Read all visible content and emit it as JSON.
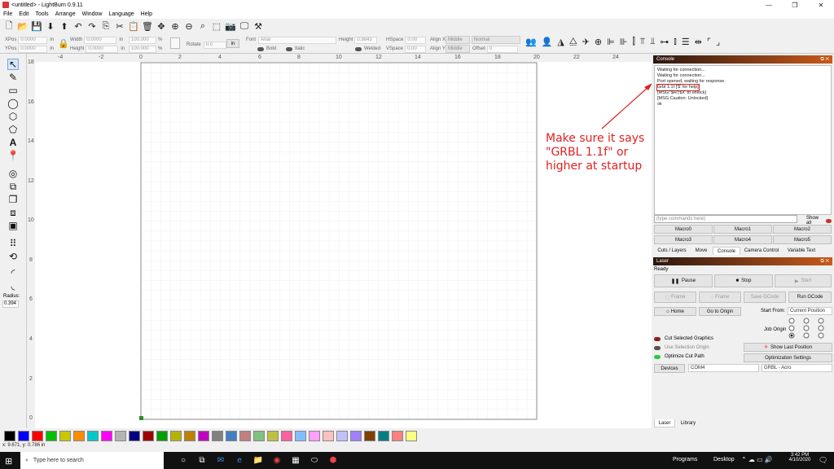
{
  "window": {
    "title": "<untitled> - LightBurn 0.9.11",
    "minimize": "—",
    "maximize": "❐",
    "close": "✕"
  },
  "menu": [
    "File",
    "Edit",
    "Tools",
    "Arrange",
    "Window",
    "Language",
    "Help"
  ],
  "props": {
    "xpos_label": "XPos",
    "xpos": "0.0000",
    "ypos_label": "YPos",
    "ypos": "0.0000",
    "unit": "in",
    "width_label": "Width",
    "width": "0.0000",
    "height_label": "Height",
    "height": "0.0000",
    "scale_w": "100.000",
    "scale_h": "100.000",
    "pct": "%",
    "rotate_label": "Rotate",
    "rotate": "0.0",
    "font_label": "Font",
    "font": "Arial",
    "bold": "Bold",
    "italic": "Italic",
    "fheight_label": "Height",
    "fheight": "0.9843",
    "welded": "Welded",
    "hspace_label": "HSpace",
    "hspace": "0.00",
    "vspace_label": "VSpace",
    "vspace": "0.00",
    "alignx_label": "Align X",
    "alignx": "Middle",
    "aligny_label": "Align Y",
    "aligny": "Middle",
    "normal": "Normal",
    "offset_label": "Offset",
    "offset": "0"
  },
  "rulers": {
    "top": [
      "-4",
      "-2",
      "0",
      "2",
      "4",
      "6",
      "8",
      "10",
      "12",
      "14",
      "16",
      "18",
      "20",
      "22",
      "24"
    ],
    "left": [
      "18",
      "16",
      "14",
      "12",
      "10",
      "8",
      "6",
      "4",
      "2",
      "0"
    ]
  },
  "radius": {
    "label": "Radius:",
    "value": "0.394"
  },
  "console": {
    "title": "Console",
    "lines": [
      "Waiting for connection...",
      "Waiting for connection...",
      "Port opened, waiting for response.",
      "Grbl 1.1f ['$' for help]",
      "[MSG:'$H'|'$X' to unlock]",
      "[MSG:Caution: Unlocked]",
      "ok"
    ],
    "cmd_placeholder": "(type commands here)",
    "show_all": "Show all"
  },
  "macros": [
    "Macro0",
    "Macro1",
    "Macro2",
    "Macro3",
    "Macro4",
    "Macro5"
  ],
  "tabs1": [
    "Cuts / Layers",
    "Move",
    "Console",
    "Camera Control",
    "Variable Text"
  ],
  "laser": {
    "title": "Laser",
    "status": "Ready",
    "pause": "Pause",
    "stop": "Stop",
    "start": "Start",
    "frame1": "Frame",
    "frame2": "Frame",
    "save_gcode": "Save GCode",
    "run_gcode": "Run GCode",
    "home": "Home",
    "go_origin": "Go to Origin",
    "start_from_label": "Start From:",
    "start_from": "Current Position",
    "job_origin": "Job Origin",
    "cut_selected": "Cut Selected Graphics",
    "use_selection": "Use Selection Origin",
    "optimize_path": "Optimize Cut Path",
    "show_last": "Show Last Position",
    "opt_settings": "Optimization Settings",
    "devices": "Devices",
    "port": "COM4",
    "device": "GRBL - Acro"
  },
  "tabs2": [
    "Laser",
    "Library"
  ],
  "palette": [
    "#000000",
    "#0000ff",
    "#ff0000",
    "#00c000",
    "#c8c800",
    "#ff8c00",
    "#00c8c8",
    "#ff00ff",
    "#b4b4b4",
    "#000080",
    "#a00000",
    "#00a000",
    "#b4b400",
    "#c08000",
    "#c000c0",
    "#808080",
    "#4080c0",
    "#c08080",
    "#80c080",
    "#c0c040",
    "#ff60a0",
    "#80c0ff",
    "#ffa0ff",
    "#ffc0c0",
    "#c0c0ff",
    "#a080ff",
    "#804000",
    "#008080",
    "#ff8080",
    "#ffff80"
  ],
  "status": "x: 9.671, y: 0.786 in",
  "taskbar": {
    "search": "Type here to search",
    "programs": "Programs",
    "desktop": "Desktop",
    "time": "3:42 PM",
    "date": "4/10/2020"
  },
  "annotation": [
    "Make sure it says",
    "\"GRBL 1.1f\" or",
    "higher at startup"
  ]
}
